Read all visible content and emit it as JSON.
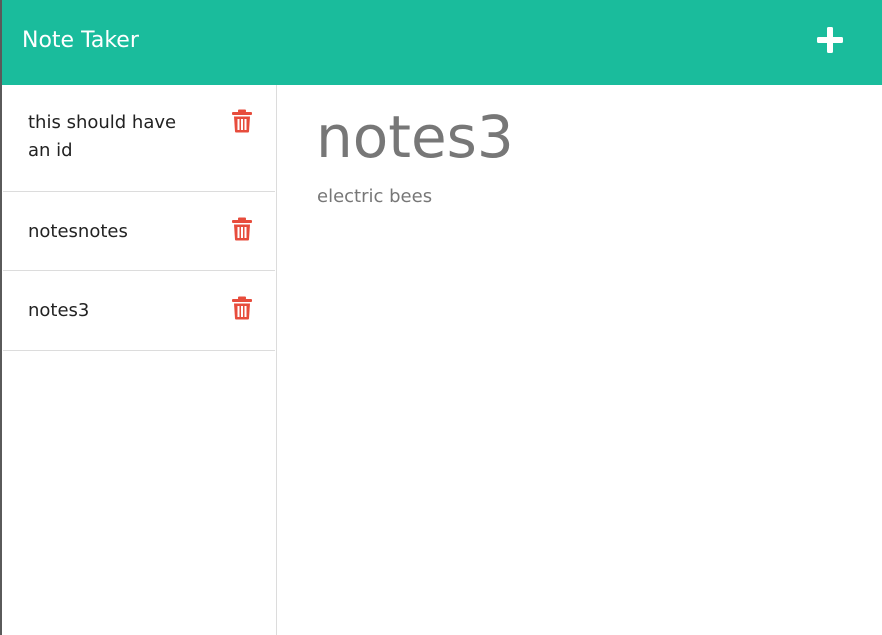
{
  "navbar": {
    "brand": "Note Taker",
    "add_icon": "plus-icon",
    "color": "#1abc9c"
  },
  "notes": [
    {
      "title": "this should have an id",
      "delete_icon": "trash-icon"
    },
    {
      "title": "notesnotes",
      "delete_icon": "trash-icon"
    },
    {
      "title": "notes3",
      "delete_icon": "trash-icon"
    }
  ],
  "active_note": {
    "title": "notes3",
    "text": "electric bees"
  },
  "colors": {
    "accent": "#1abc9c",
    "delete": "#e74c3c",
    "muted_text": "#777777"
  }
}
